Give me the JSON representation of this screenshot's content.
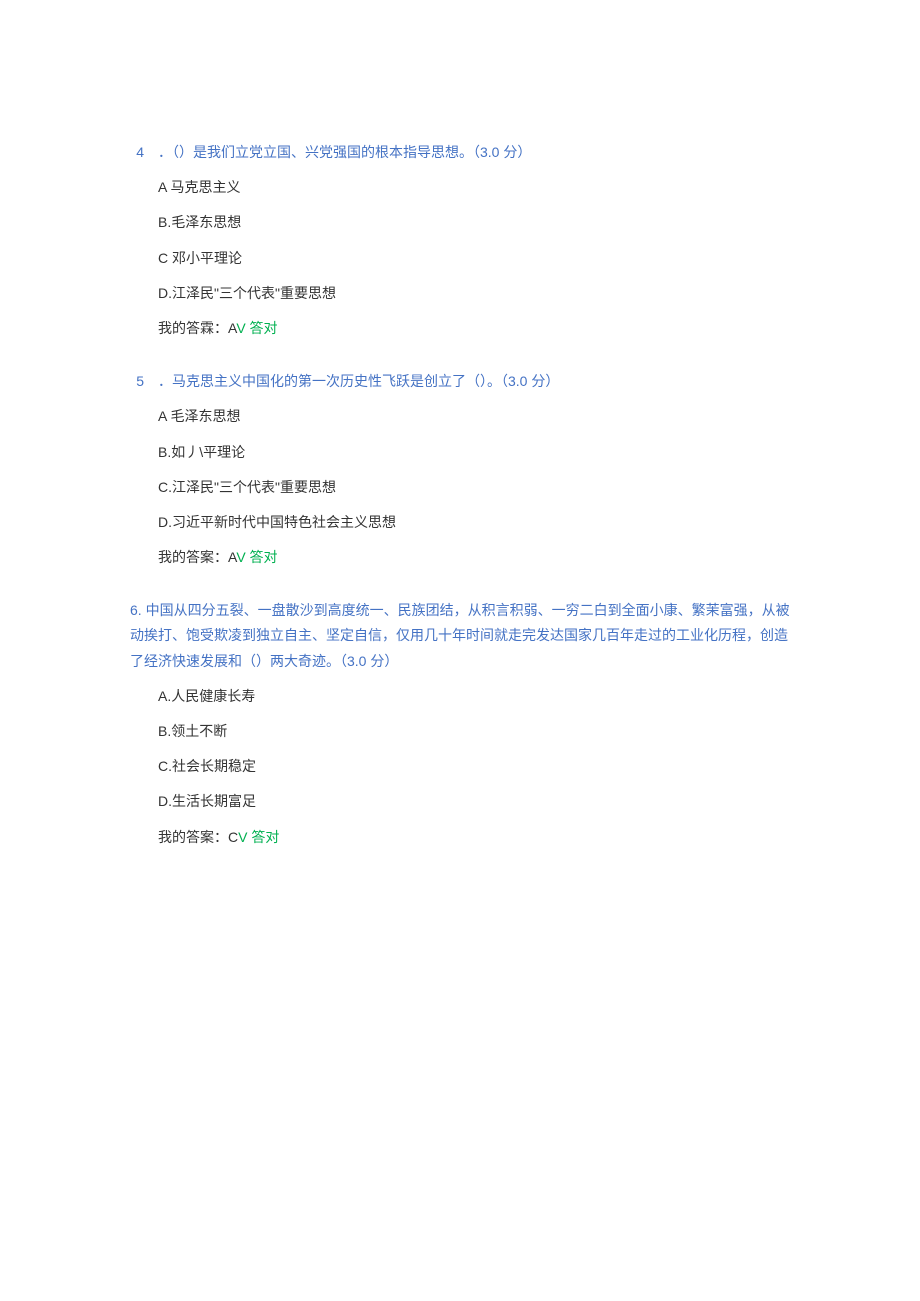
{
  "questions": [
    {
      "number": "4",
      "stem_pre": "．（）是我们立党立国、兴党强国的根本指导思想。（",
      "points": "3.0 分",
      "stem_post": "）",
      "options": [
        "A 马克思主义",
        "B.毛泽东思想",
        "C 邓小平理论",
        "D.江泽民\"三个代表\"重要思想"
      ],
      "answer_label": "我的答霖：",
      "answer_letter": "A",
      "answer_result": "V 答对"
    },
    {
      "number": "5",
      "stem_pre": "．马克思主义中国化的第一次历史性飞跃是创立了（）。（",
      "points": "3.0 分",
      "stem_post": "）",
      "options": [
        "A 毛泽东思想",
        "B.如丿\\平理论",
        "C.江泽民\"三个代表\"重要思想",
        "D.习近平新时代中国特色社会主义思想"
      ],
      "answer_label": "我的答案：",
      "answer_letter": "A",
      "answer_result": "V 答对"
    },
    {
      "number": "6.",
      "stem_full": "中国从四分五裂、一盘散沙到高度统一、民族团结，从积言积弱、一穷二白到全面小康、繁茉富强，从被动挨打、饱受欺凌到独立自主、坚定自信，仅用几十年时间就走完发达国家几百年走过的工业化历程，创造了经济快速发展和（）两大奇迹。（",
      "points": "3.0 分",
      "stem_post": "）",
      "options": [
        "A.人民健康长寿",
        "B.领土不断",
        "C.社会长期稳定",
        "D.生活长期富足"
      ],
      "answer_label": "我的答案：",
      "answer_letter": "C",
      "answer_result": "V 答对"
    }
  ]
}
